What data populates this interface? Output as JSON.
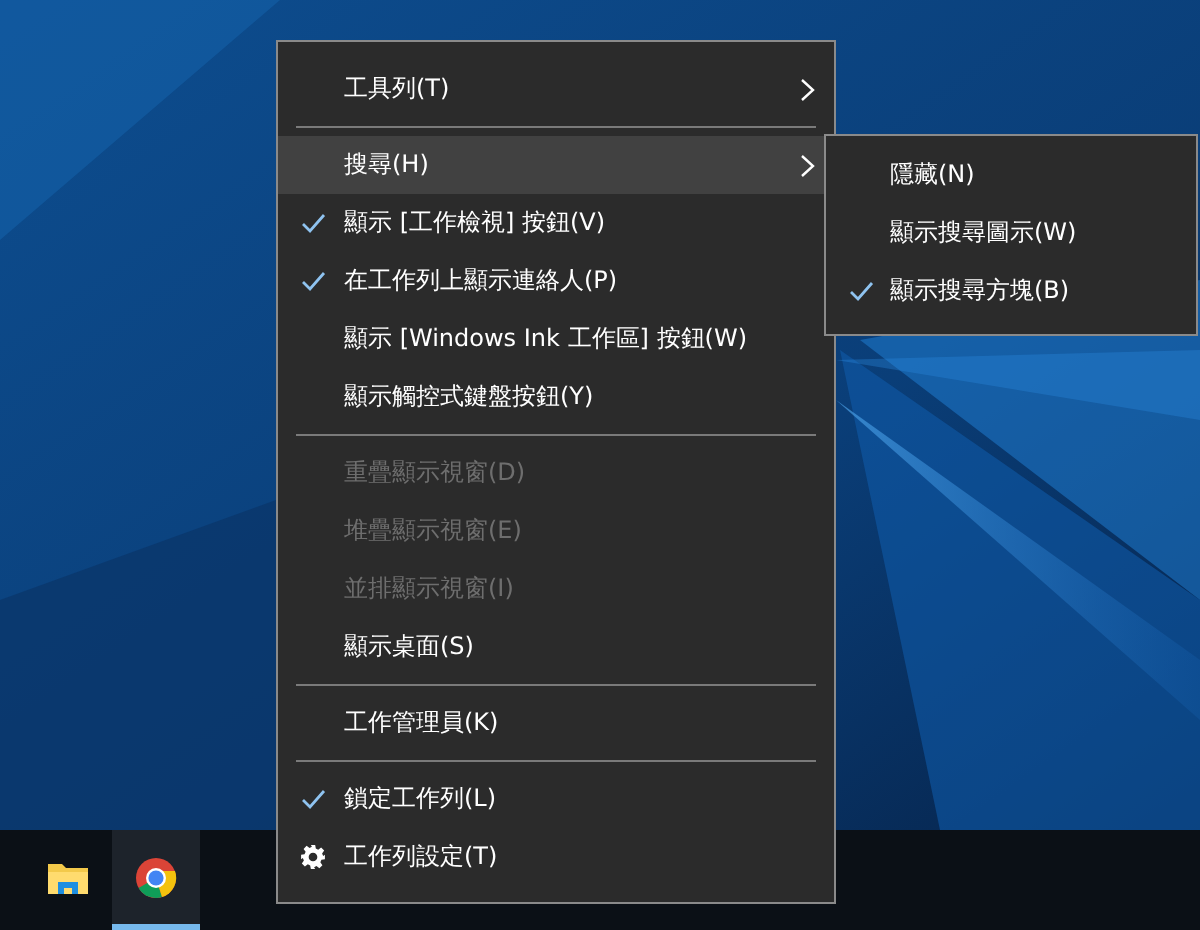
{
  "context_menu": {
    "items": [
      {
        "kind": "item",
        "label": "工具列(T)",
        "checked": false,
        "disabled": false,
        "selected": false,
        "submenu": true
      },
      {
        "kind": "separator"
      },
      {
        "kind": "item",
        "label": "搜尋(H)",
        "checked": false,
        "disabled": false,
        "selected": true,
        "submenu": true
      },
      {
        "kind": "item",
        "label": "顯示 [工作檢視] 按鈕(V)",
        "checked": true,
        "disabled": false,
        "selected": false,
        "submenu": false
      },
      {
        "kind": "item",
        "label": "在工作列上顯示連絡人(P)",
        "checked": true,
        "disabled": false,
        "selected": false,
        "submenu": false
      },
      {
        "kind": "item",
        "label": "顯示 [Windows Ink 工作區] 按鈕(W)",
        "checked": false,
        "disabled": false,
        "selected": false,
        "submenu": false
      },
      {
        "kind": "item",
        "label": "顯示觸控式鍵盤按鈕(Y)",
        "checked": false,
        "disabled": false,
        "selected": false,
        "submenu": false
      },
      {
        "kind": "separator"
      },
      {
        "kind": "item",
        "label": "重疊顯示視窗(D)",
        "checked": false,
        "disabled": true,
        "selected": false,
        "submenu": false
      },
      {
        "kind": "item",
        "label": "堆疊顯示視窗(E)",
        "checked": false,
        "disabled": true,
        "selected": false,
        "submenu": false
      },
      {
        "kind": "item",
        "label": "並排顯示視窗(I)",
        "checked": false,
        "disabled": true,
        "selected": false,
        "submenu": false
      },
      {
        "kind": "item",
        "label": "顯示桌面(S)",
        "checked": false,
        "disabled": false,
        "selected": false,
        "submenu": false
      },
      {
        "kind": "separator"
      },
      {
        "kind": "item",
        "label": "工作管理員(K)",
        "checked": false,
        "disabled": false,
        "selected": false,
        "submenu": false
      },
      {
        "kind": "separator"
      },
      {
        "kind": "item",
        "label": "鎖定工作列(L)",
        "checked": true,
        "disabled": false,
        "selected": false,
        "submenu": false
      },
      {
        "kind": "settings",
        "label": "工作列設定(T)",
        "checked": false,
        "disabled": false,
        "selected": false,
        "submenu": false
      }
    ]
  },
  "submenu": {
    "items": [
      {
        "label": "隱藏(N)",
        "checked": false
      },
      {
        "label": "顯示搜尋圖示(W)",
        "checked": false
      },
      {
        "label": "顯示搜尋方塊(B)",
        "checked": true
      }
    ]
  },
  "taskbar": {
    "apps": [
      {
        "kind": "folder",
        "running": false
      },
      {
        "kind": "browser",
        "running": true
      }
    ]
  }
}
